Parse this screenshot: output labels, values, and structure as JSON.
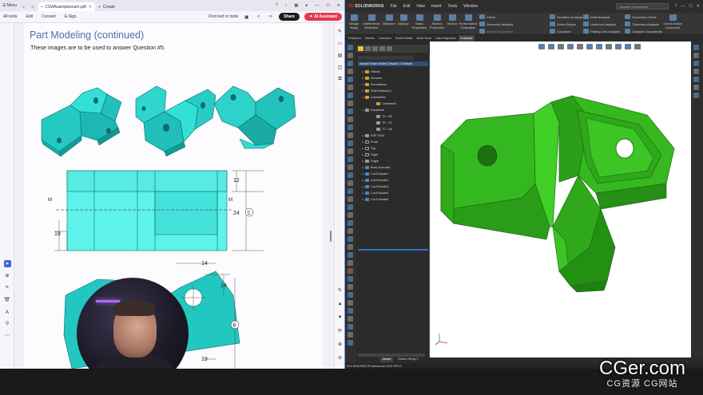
{
  "pdf": {
    "menu_label": "Menu",
    "tab_title": "CSWAsampleexam.pdf",
    "new_tab_label": "Create",
    "toolbar": {
      "all_tools": "All tools",
      "edit": "Edit",
      "convert": "Convert",
      "esign": "E-Sign",
      "find_text": "Find text or tools",
      "share": "Share",
      "ai_assistant": "AI Assistant"
    },
    "page": {
      "title": "Part Modeling (continued)",
      "subtitle": "These images are to be used to answer Question #5."
    },
    "dimensions": {
      "d12": "12",
      "d24": "24",
      "c_label": "C",
      "d19_top": "19",
      "m_left": "M",
      "m_right": "M",
      "d14_top": "14",
      "d14_side": "14",
      "b_label": "B",
      "d19_bottom": "19"
    }
  },
  "solidworks": {
    "logo": "SOLIDWORKS",
    "menus": [
      "File",
      "Edit",
      "View",
      "Insert",
      "Tools",
      "Window"
    ],
    "search_placeholder": "Search Commands",
    "commands": {
      "design_study": "Design Study",
      "interference": "Interference Detection",
      "measure": "Measure",
      "markup": "Markup",
      "mass_properties": "Mass Properties",
      "section_properties": "Section Properties",
      "sensor": "Sensor",
      "performance": "Performance Evaluation",
      "check": "Check",
      "geometry_analysis": "Geometry Analysis",
      "import_diagnostics": "Import Diagnostics",
      "deviation_analysis": "Deviation Analysis",
      "zebra_stripes": "Zebra Stripes",
      "curvature": "Curvature",
      "draft_analysis": "Draft Analysis",
      "undercut_analysis": "Undercut Analysis",
      "parting_line": "Parting Line Analysis",
      "symmetry_check": "Symmetry Check",
      "thickness_analysis": "Thickness Analysis",
      "compare_documents": "Compare Documents",
      "check_active": "Check Active Document"
    },
    "tabs": [
      "Features",
      "Sketch",
      "Surfaces",
      "Sheet Metal",
      "Mold Tools",
      "Data Migration",
      "Evaluate"
    ],
    "active_tab": "Evaluate",
    "tree": {
      "root": "Sample Exam Model (Default) <<Default>",
      "items": [
        {
          "label": "History",
          "level": 1,
          "icon": "history-icon"
        },
        {
          "label": "Sensors",
          "level": 1,
          "icon": "sensor-icon"
        },
        {
          "label": "Annotations",
          "level": 1,
          "icon": "annotation-icon"
        },
        {
          "label": "Solid Bodies(1)",
          "level": 1,
          "icon": "solid-bodies-icon"
        },
        {
          "label": "Comments",
          "level": 1,
          "icon": "comment-icon"
        },
        {
          "label": "Comment1",
          "level": 2,
          "icon": "comment-icon"
        },
        {
          "label": "Equations",
          "level": 1,
          "icon": "equation-icon"
        },
        {
          "label": "\"A\" =30",
          "level": 2,
          "icon": "equation-icon"
        },
        {
          "label": "\"B\" =70",
          "level": 2,
          "icon": "equation-icon"
        },
        {
          "label": "\"C\" =46",
          "level": 2,
          "icon": "equation-icon"
        },
        {
          "label": "AISI 1020",
          "level": 1,
          "icon": "material-icon"
        },
        {
          "label": "Front",
          "level": 1,
          "icon": "plane-icon"
        },
        {
          "label": "Top",
          "level": 1,
          "icon": "plane-icon"
        },
        {
          "label": "Right",
          "level": 1,
          "icon": "plane-icon"
        },
        {
          "label": "Origin",
          "level": 1,
          "icon": "origin-icon"
        },
        {
          "label": "Boss-Extrude1",
          "level": 1,
          "icon": "boss-icon"
        },
        {
          "label": "Cut-Extrude1",
          "level": 1,
          "icon": "cut-icon"
        },
        {
          "label": "Cut-Extrude2",
          "level": 1,
          "icon": "cut-icon"
        },
        {
          "label": "Cut-Extrude3",
          "level": 1,
          "icon": "cut-icon"
        },
        {
          "label": "Cut-Extrude4",
          "level": 1,
          "icon": "cut-icon"
        },
        {
          "label": "Cut-Extrude5",
          "level": 1,
          "icon": "cut-icon"
        }
      ]
    },
    "model_tabs": [
      "Model",
      "Motion Study 1"
    ],
    "active_model_tab": "Model",
    "status": "SOLIDWORKS Professional 2023 SP5.0",
    "part_color": "#2fa81c"
  },
  "watermark": {
    "main": "CGer.com",
    "sub": "CG资源 CG网站"
  }
}
